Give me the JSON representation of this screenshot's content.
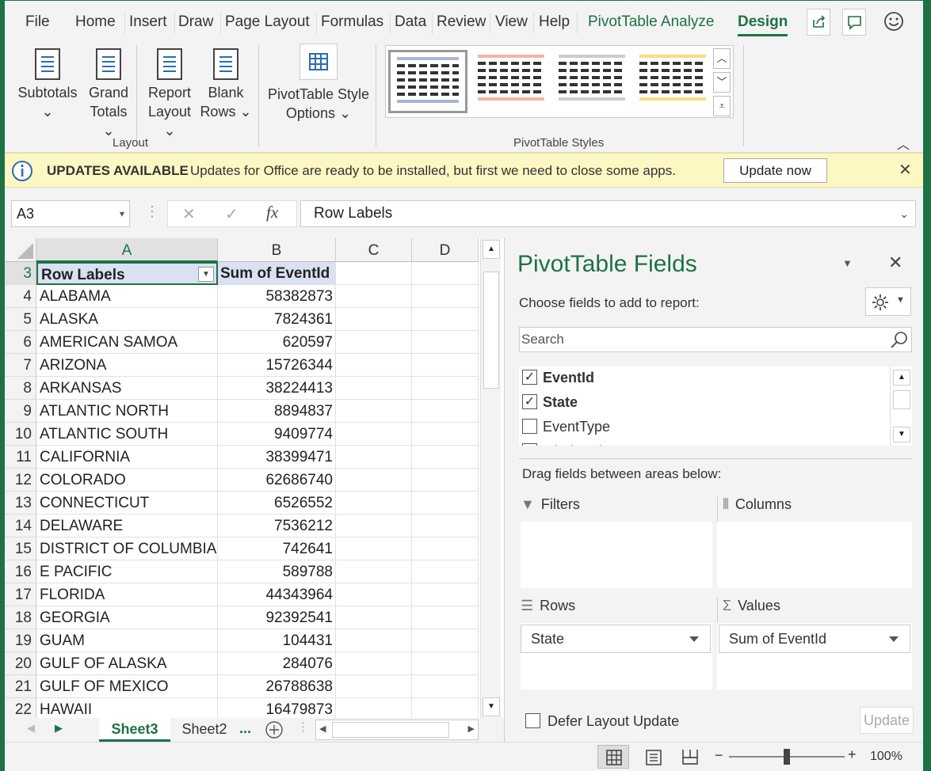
{
  "tabs": [
    "File",
    "Home",
    "Insert",
    "Draw",
    "Page Layout",
    "Formulas",
    "Data",
    "Review",
    "View",
    "Help",
    "PivotTable Analyze",
    "Design"
  ],
  "ribbon": {
    "subtotals": "Subtotals",
    "grand_totals_1": "Grand",
    "grand_totals_2": "Totals",
    "report_layout_1": "Report",
    "report_layout_2": "Layout",
    "blank_rows_1": "Blank",
    "blank_rows_2": "Rows",
    "style_options_1": "PivotTable Style",
    "style_options_2": "Options",
    "layout_group": "Layout",
    "styles_group": "PivotTable Styles",
    "style_colors": [
      "#a9b7d6",
      "#f4b4a4",
      "#cccccc",
      "#f8dc84"
    ]
  },
  "infobar": {
    "title": "UPDATES AVAILABLE",
    "message": "Updates for Office are ready to be installed, but first we need to close some apps.",
    "button": "Update now"
  },
  "formula": {
    "namebox": "A3",
    "fx": "fx",
    "content": "Row Labels"
  },
  "columns": [
    "A",
    "B",
    "C",
    "D"
  ],
  "header_row": {
    "row": "3",
    "label": "Row Labels",
    "value": "Sum of EventId"
  },
  "rows": [
    {
      "n": "4",
      "label": "ALABAMA",
      "value": "58382873"
    },
    {
      "n": "5",
      "label": "ALASKA",
      "value": "7824361"
    },
    {
      "n": "6",
      "label": "AMERICAN SAMOA",
      "value": "620597"
    },
    {
      "n": "7",
      "label": "ARIZONA",
      "value": "15726344"
    },
    {
      "n": "8",
      "label": "ARKANSAS",
      "value": "38224413"
    },
    {
      "n": "9",
      "label": "ATLANTIC NORTH",
      "value": "8894837"
    },
    {
      "n": "10",
      "label": "ATLANTIC SOUTH",
      "value": "9409774"
    },
    {
      "n": "11",
      "label": "CALIFORNIA",
      "value": "38399471"
    },
    {
      "n": "12",
      "label": "COLORADO",
      "value": "62686740"
    },
    {
      "n": "13",
      "label": "CONNECTICUT",
      "value": "6526552"
    },
    {
      "n": "14",
      "label": "DELAWARE",
      "value": "7536212"
    },
    {
      "n": "15",
      "label": "DISTRICT OF COLUMBIA",
      "value": "742641"
    },
    {
      "n": "16",
      "label": "E PACIFIC",
      "value": "589788"
    },
    {
      "n": "17",
      "label": "FLORIDA",
      "value": "44343964"
    },
    {
      "n": "18",
      "label": "GEORGIA",
      "value": "92392541"
    },
    {
      "n": "19",
      "label": "GUAM",
      "value": "104431"
    },
    {
      "n": "20",
      "label": "GULF OF ALASKA",
      "value": "284076"
    },
    {
      "n": "21",
      "label": "GULF OF MEXICO",
      "value": "26788638"
    },
    {
      "n": "22",
      "label": "HAWAII",
      "value": "16479873"
    }
  ],
  "sheets": {
    "active": "Sheet3",
    "other": "Sheet2",
    "more": "..."
  },
  "pane": {
    "title": "PivotTable Fields",
    "choose": "Choose fields to add to report:",
    "search_placeholder": "Search",
    "fields": [
      {
        "name": "EventId",
        "checked": true
      },
      {
        "name": "State",
        "checked": true
      },
      {
        "name": "EventType",
        "checked": false
      },
      {
        "name": "InjuriesDirect",
        "checked": false
      }
    ],
    "drag": "Drag fields between areas below:",
    "filters": "Filters",
    "columns": "Columns",
    "rows": "Rows",
    "values": "Values",
    "rows_field": "State",
    "values_field": "Sum of EventId",
    "defer": "Defer Layout Update",
    "update": "Update"
  },
  "status": {
    "zoom": "100%"
  }
}
